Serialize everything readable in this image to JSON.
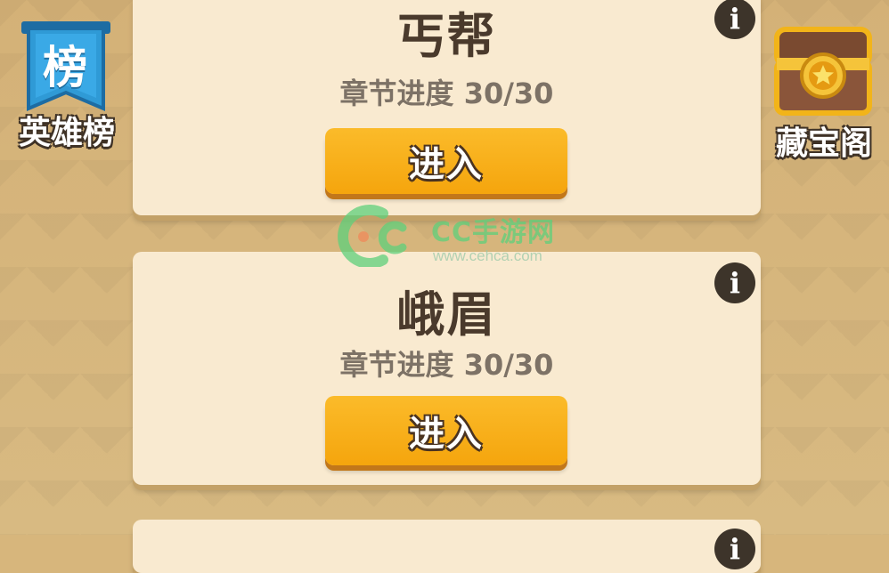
{
  "left_button": {
    "banner_char": "榜",
    "label": "英雄榜"
  },
  "right_button": {
    "label": "藏宝阁"
  },
  "chapters": [
    {
      "title": "丐帮",
      "progress": "章节进度 30/30",
      "button_label": "进入"
    },
    {
      "title": "峨眉",
      "progress": "章节进度 30/30",
      "button_label": "进入"
    }
  ],
  "info_icon_glyph": "i",
  "watermark": {
    "title": "CC手游网",
    "url": "www.cehca.com"
  },
  "colors": {
    "background": "#d7b67c",
    "card": "#f9ead0",
    "button": "#f5a50d",
    "banner_blue": "#2f9ad6",
    "watermark_green": "#5fd07b"
  }
}
